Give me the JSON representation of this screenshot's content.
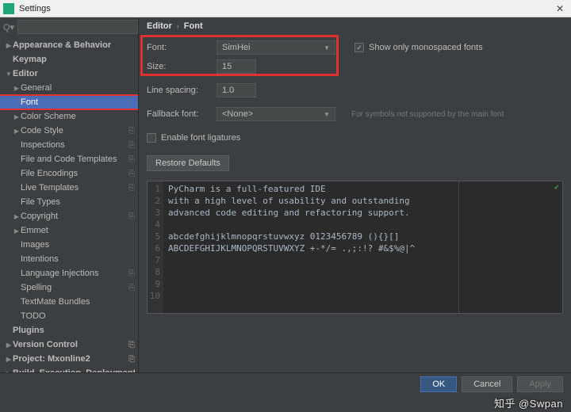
{
  "window": {
    "title": "Settings",
    "close_glyph": "✕"
  },
  "search": {
    "placeholder": "",
    "value": ""
  },
  "tree": [
    {
      "label": "Appearance & Behavior",
      "depth": 0,
      "arrow": "▶",
      "top": true,
      "cfg": false
    },
    {
      "label": "Keymap",
      "depth": 0,
      "arrow": "",
      "top": true,
      "cfg": false
    },
    {
      "label": "Editor",
      "depth": 0,
      "arrow": "▼",
      "top": true,
      "cfg": false
    },
    {
      "label": "General",
      "depth": 1,
      "arrow": "▶",
      "cfg": false
    },
    {
      "label": "Font",
      "depth": 1,
      "arrow": "",
      "selected": true,
      "redbox": true,
      "cfg": false
    },
    {
      "label": "Color Scheme",
      "depth": 1,
      "arrow": "▶",
      "cfg": false
    },
    {
      "label": "Code Style",
      "depth": 1,
      "arrow": "▶",
      "cfg": true
    },
    {
      "label": "Inspections",
      "depth": 1,
      "arrow": "",
      "cfg": true
    },
    {
      "label": "File and Code Templates",
      "depth": 1,
      "arrow": "",
      "cfg": true
    },
    {
      "label": "File Encodings",
      "depth": 1,
      "arrow": "",
      "cfg": true
    },
    {
      "label": "Live Templates",
      "depth": 1,
      "arrow": "",
      "cfg": true
    },
    {
      "label": "File Types",
      "depth": 1,
      "arrow": "",
      "cfg": false
    },
    {
      "label": "Copyright",
      "depth": 1,
      "arrow": "▶",
      "cfg": true
    },
    {
      "label": "Emmet",
      "depth": 1,
      "arrow": "▶",
      "cfg": false
    },
    {
      "label": "Images",
      "depth": 1,
      "arrow": "",
      "cfg": false
    },
    {
      "label": "Intentions",
      "depth": 1,
      "arrow": "",
      "cfg": false
    },
    {
      "label": "Language Injections",
      "depth": 1,
      "arrow": "",
      "cfg": true
    },
    {
      "label": "Spelling",
      "depth": 1,
      "arrow": "",
      "cfg": true
    },
    {
      "label": "TextMate Bundles",
      "depth": 1,
      "arrow": "",
      "cfg": false
    },
    {
      "label": "TODO",
      "depth": 1,
      "arrow": "",
      "cfg": false
    },
    {
      "label": "Plugins",
      "depth": 0,
      "arrow": "",
      "top": true,
      "cfg": false
    },
    {
      "label": "Version Control",
      "depth": 0,
      "arrow": "▶",
      "top": true,
      "cfg": true
    },
    {
      "label": "Project: Mxonline2",
      "depth": 0,
      "arrow": "▶",
      "top": true,
      "cfg": true
    },
    {
      "label": "Build, Execution, Deployment",
      "depth": 0,
      "arrow": "▶",
      "top": true,
      "cfg": false
    }
  ],
  "breadcrumb": {
    "parent": "Editor",
    "sep": "›",
    "current": "Font"
  },
  "form": {
    "font_label": "Font:",
    "font_value": "SimHei",
    "size_label": "Size:",
    "size_value": "15",
    "show_mono_label": "Show only monospaced fonts",
    "show_mono_checked": "✓",
    "line_spacing_label": "Line spacing:",
    "line_spacing_value": "1.0",
    "fallback_label": "Fallback font:",
    "fallback_value": "<None>",
    "fallback_hint": "For symbols not supported by the main font",
    "ligatures_label": "Enable font ligatures",
    "restore_label": "Restore Defaults"
  },
  "preview": {
    "lines": [
      "PyCharm is a full-featured IDE",
      "with a high level of usability and outstanding",
      "advanced code editing and refactoring support.",
      "",
      "abcdefghijklmnopqrstuvwxyz 0123456789 (){}[]",
      "ABCDEFGHIJKLMNOPQRSTUVWXYZ +-*/= .,;:!? #&$%@|^",
      "",
      "",
      "",
      ""
    ]
  },
  "footer": {
    "ok": "OK",
    "cancel": "Cancel",
    "apply": "Apply",
    "help": "?"
  },
  "watermark": "知乎 @Swpan"
}
